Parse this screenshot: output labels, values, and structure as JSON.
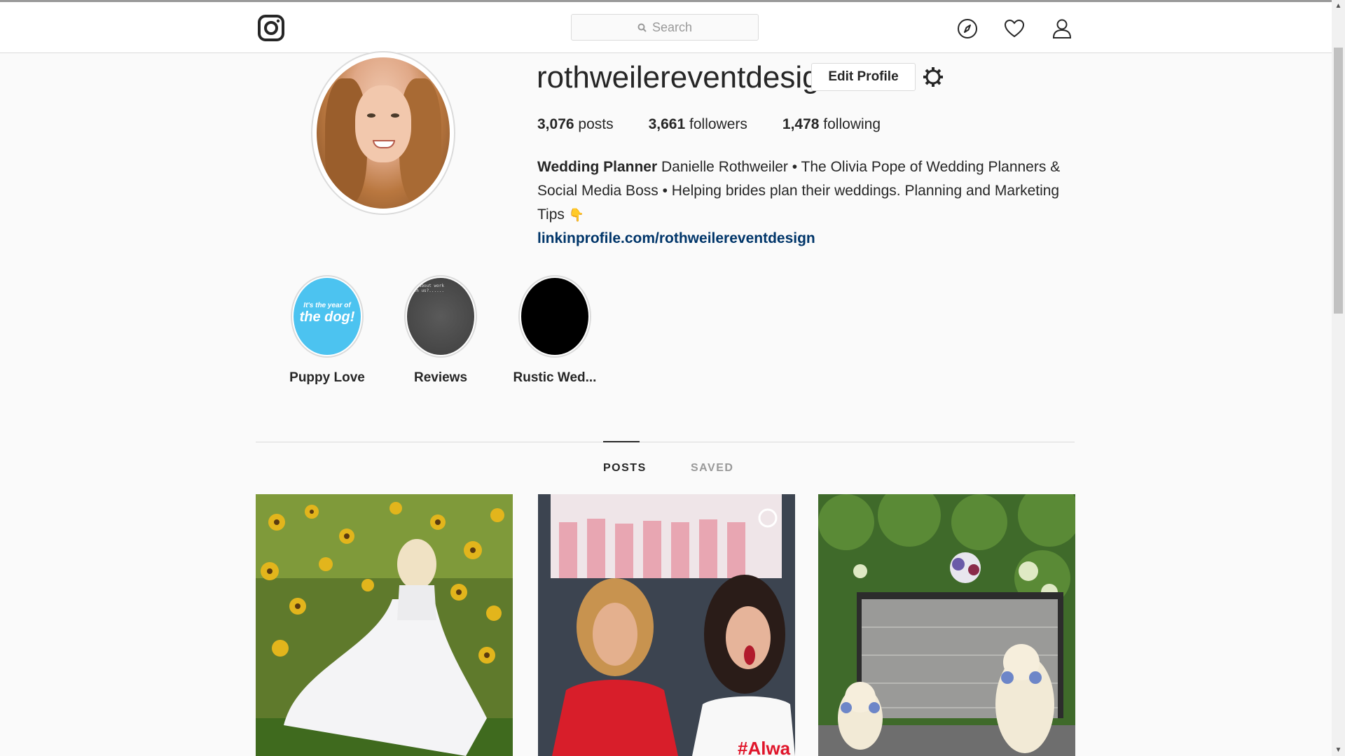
{
  "header": {
    "logo_icon": "instagram-icon",
    "search_placeholder": "Search",
    "icons": [
      "compass-icon",
      "heart-icon",
      "user-icon"
    ]
  },
  "profile": {
    "username": "rothweilereventdesign",
    "edit_profile_label": "Edit Profile",
    "stats": {
      "posts_count": "3,076",
      "posts_label": "posts",
      "followers_count": "3,661",
      "followers_label": "followers",
      "following_count": "1,478",
      "following_label": "following"
    },
    "bio": {
      "bold_title": "Wedding Planner",
      "text": "Danielle Rothweiler • The Olivia Pope of Wedding Planners & Social Media Boss • Helping brides plan their weddings. Planning and Marketing Tips",
      "emoji": "👇",
      "link": "linkinprofile.com/rothweilereventdesign"
    }
  },
  "highlights": [
    {
      "label": "Puppy Love",
      "cover_small": "It's the year of",
      "cover_big": "the dog!",
      "color": "#4cc3f0"
    },
    {
      "label": "Reviews",
      "cover_text": "ng about work\nith us?......",
      "color": "#4a4a4a"
    },
    {
      "label": "Rustic Wed...",
      "color": "#000000"
    }
  ],
  "tabs": [
    {
      "label": "POSTS",
      "active": true
    },
    {
      "label": "SAVED",
      "active": false
    }
  ],
  "posts": [
    {
      "name": "bride-sunflowers",
      "overlay_text": ""
    },
    {
      "name": "two-women-video",
      "overlay_text": "#Alwa"
    },
    {
      "name": "dogs-bar",
      "overlay_text": ""
    }
  ],
  "colors": {
    "link": "#003569",
    "border": "#dbdbdb",
    "background": "#fafafa"
  }
}
